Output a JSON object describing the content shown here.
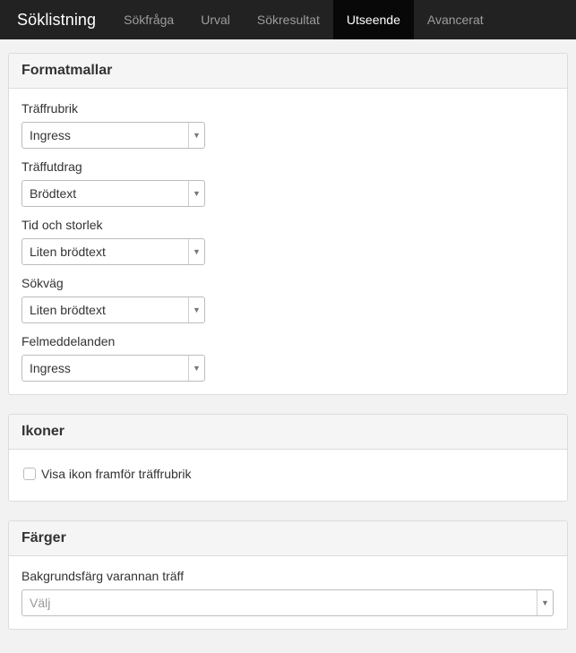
{
  "navbar": {
    "brand": "Söklistning",
    "tabs": [
      {
        "label": "Sökfråga"
      },
      {
        "label": "Urval"
      },
      {
        "label": "Sökresultat"
      },
      {
        "label": "Utseende",
        "active": true
      },
      {
        "label": "Avancerat"
      }
    ]
  },
  "formatmallar": {
    "heading": "Formatmallar",
    "fields": [
      {
        "label": "Träffrubrik",
        "value": "Ingress"
      },
      {
        "label": "Träffutdrag",
        "value": "Brödtext"
      },
      {
        "label": "Tid och storlek",
        "value": "Liten brödtext"
      },
      {
        "label": "Sökväg",
        "value": "Liten brödtext"
      },
      {
        "label": "Felmeddelanden",
        "value": "Ingress"
      }
    ]
  },
  "ikoner": {
    "heading": "Ikoner",
    "checkbox_label": "Visa ikon framför träffrubrik",
    "checked": false
  },
  "farger": {
    "heading": "Färger",
    "field_label": "Bakgrundsfärg varannan träff",
    "placeholder": "Välj"
  },
  "icons": {
    "select_arrow": "chevron-down-icon"
  }
}
